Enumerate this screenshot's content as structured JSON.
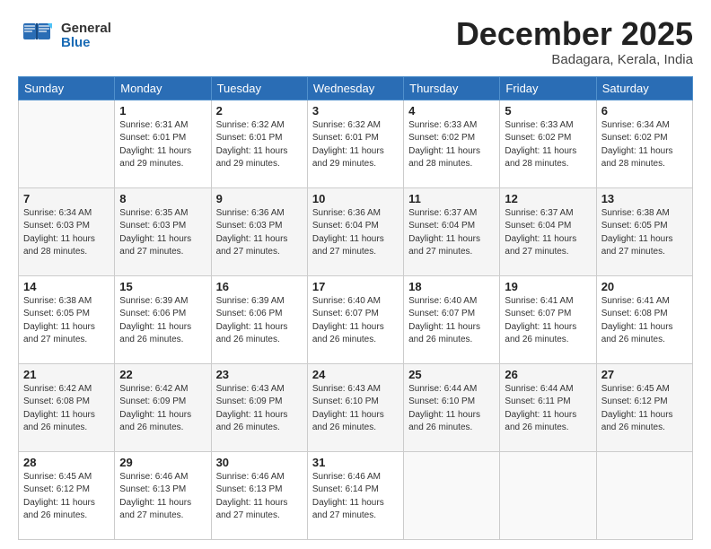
{
  "logo": {
    "general": "General",
    "blue": "Blue"
  },
  "title": "December 2025",
  "location": "Badagara, Kerala, India",
  "weekdays": [
    "Sunday",
    "Monday",
    "Tuesday",
    "Wednesday",
    "Thursday",
    "Friday",
    "Saturday"
  ],
  "weeks": [
    [
      {
        "day": "",
        "info": ""
      },
      {
        "day": "1",
        "info": "Sunrise: 6:31 AM\nSunset: 6:01 PM\nDaylight: 11 hours\nand 29 minutes."
      },
      {
        "day": "2",
        "info": "Sunrise: 6:32 AM\nSunset: 6:01 PM\nDaylight: 11 hours\nand 29 minutes."
      },
      {
        "day": "3",
        "info": "Sunrise: 6:32 AM\nSunset: 6:01 PM\nDaylight: 11 hours\nand 29 minutes."
      },
      {
        "day": "4",
        "info": "Sunrise: 6:33 AM\nSunset: 6:02 PM\nDaylight: 11 hours\nand 28 minutes."
      },
      {
        "day": "5",
        "info": "Sunrise: 6:33 AM\nSunset: 6:02 PM\nDaylight: 11 hours\nand 28 minutes."
      },
      {
        "day": "6",
        "info": "Sunrise: 6:34 AM\nSunset: 6:02 PM\nDaylight: 11 hours\nand 28 minutes."
      }
    ],
    [
      {
        "day": "7",
        "info": "Sunrise: 6:34 AM\nSunset: 6:03 PM\nDaylight: 11 hours\nand 28 minutes."
      },
      {
        "day": "8",
        "info": "Sunrise: 6:35 AM\nSunset: 6:03 PM\nDaylight: 11 hours\nand 27 minutes."
      },
      {
        "day": "9",
        "info": "Sunrise: 6:36 AM\nSunset: 6:03 PM\nDaylight: 11 hours\nand 27 minutes."
      },
      {
        "day": "10",
        "info": "Sunrise: 6:36 AM\nSunset: 6:04 PM\nDaylight: 11 hours\nand 27 minutes."
      },
      {
        "day": "11",
        "info": "Sunrise: 6:37 AM\nSunset: 6:04 PM\nDaylight: 11 hours\nand 27 minutes."
      },
      {
        "day": "12",
        "info": "Sunrise: 6:37 AM\nSunset: 6:04 PM\nDaylight: 11 hours\nand 27 minutes."
      },
      {
        "day": "13",
        "info": "Sunrise: 6:38 AM\nSunset: 6:05 PM\nDaylight: 11 hours\nand 27 minutes."
      }
    ],
    [
      {
        "day": "14",
        "info": "Sunrise: 6:38 AM\nSunset: 6:05 PM\nDaylight: 11 hours\nand 27 minutes."
      },
      {
        "day": "15",
        "info": "Sunrise: 6:39 AM\nSunset: 6:06 PM\nDaylight: 11 hours\nand 26 minutes."
      },
      {
        "day": "16",
        "info": "Sunrise: 6:39 AM\nSunset: 6:06 PM\nDaylight: 11 hours\nand 26 minutes."
      },
      {
        "day": "17",
        "info": "Sunrise: 6:40 AM\nSunset: 6:07 PM\nDaylight: 11 hours\nand 26 minutes."
      },
      {
        "day": "18",
        "info": "Sunrise: 6:40 AM\nSunset: 6:07 PM\nDaylight: 11 hours\nand 26 minutes."
      },
      {
        "day": "19",
        "info": "Sunrise: 6:41 AM\nSunset: 6:07 PM\nDaylight: 11 hours\nand 26 minutes."
      },
      {
        "day": "20",
        "info": "Sunrise: 6:41 AM\nSunset: 6:08 PM\nDaylight: 11 hours\nand 26 minutes."
      }
    ],
    [
      {
        "day": "21",
        "info": "Sunrise: 6:42 AM\nSunset: 6:08 PM\nDaylight: 11 hours\nand 26 minutes."
      },
      {
        "day": "22",
        "info": "Sunrise: 6:42 AM\nSunset: 6:09 PM\nDaylight: 11 hours\nand 26 minutes."
      },
      {
        "day": "23",
        "info": "Sunrise: 6:43 AM\nSunset: 6:09 PM\nDaylight: 11 hours\nand 26 minutes."
      },
      {
        "day": "24",
        "info": "Sunrise: 6:43 AM\nSunset: 6:10 PM\nDaylight: 11 hours\nand 26 minutes."
      },
      {
        "day": "25",
        "info": "Sunrise: 6:44 AM\nSunset: 6:10 PM\nDaylight: 11 hours\nand 26 minutes."
      },
      {
        "day": "26",
        "info": "Sunrise: 6:44 AM\nSunset: 6:11 PM\nDaylight: 11 hours\nand 26 minutes."
      },
      {
        "day": "27",
        "info": "Sunrise: 6:45 AM\nSunset: 6:12 PM\nDaylight: 11 hours\nand 26 minutes."
      }
    ],
    [
      {
        "day": "28",
        "info": "Sunrise: 6:45 AM\nSunset: 6:12 PM\nDaylight: 11 hours\nand 26 minutes."
      },
      {
        "day": "29",
        "info": "Sunrise: 6:46 AM\nSunset: 6:13 PM\nDaylight: 11 hours\nand 27 minutes."
      },
      {
        "day": "30",
        "info": "Sunrise: 6:46 AM\nSunset: 6:13 PM\nDaylight: 11 hours\nand 27 minutes."
      },
      {
        "day": "31",
        "info": "Sunrise: 6:46 AM\nSunset: 6:14 PM\nDaylight: 11 hours\nand 27 minutes."
      },
      {
        "day": "",
        "info": ""
      },
      {
        "day": "",
        "info": ""
      },
      {
        "day": "",
        "info": ""
      }
    ]
  ]
}
